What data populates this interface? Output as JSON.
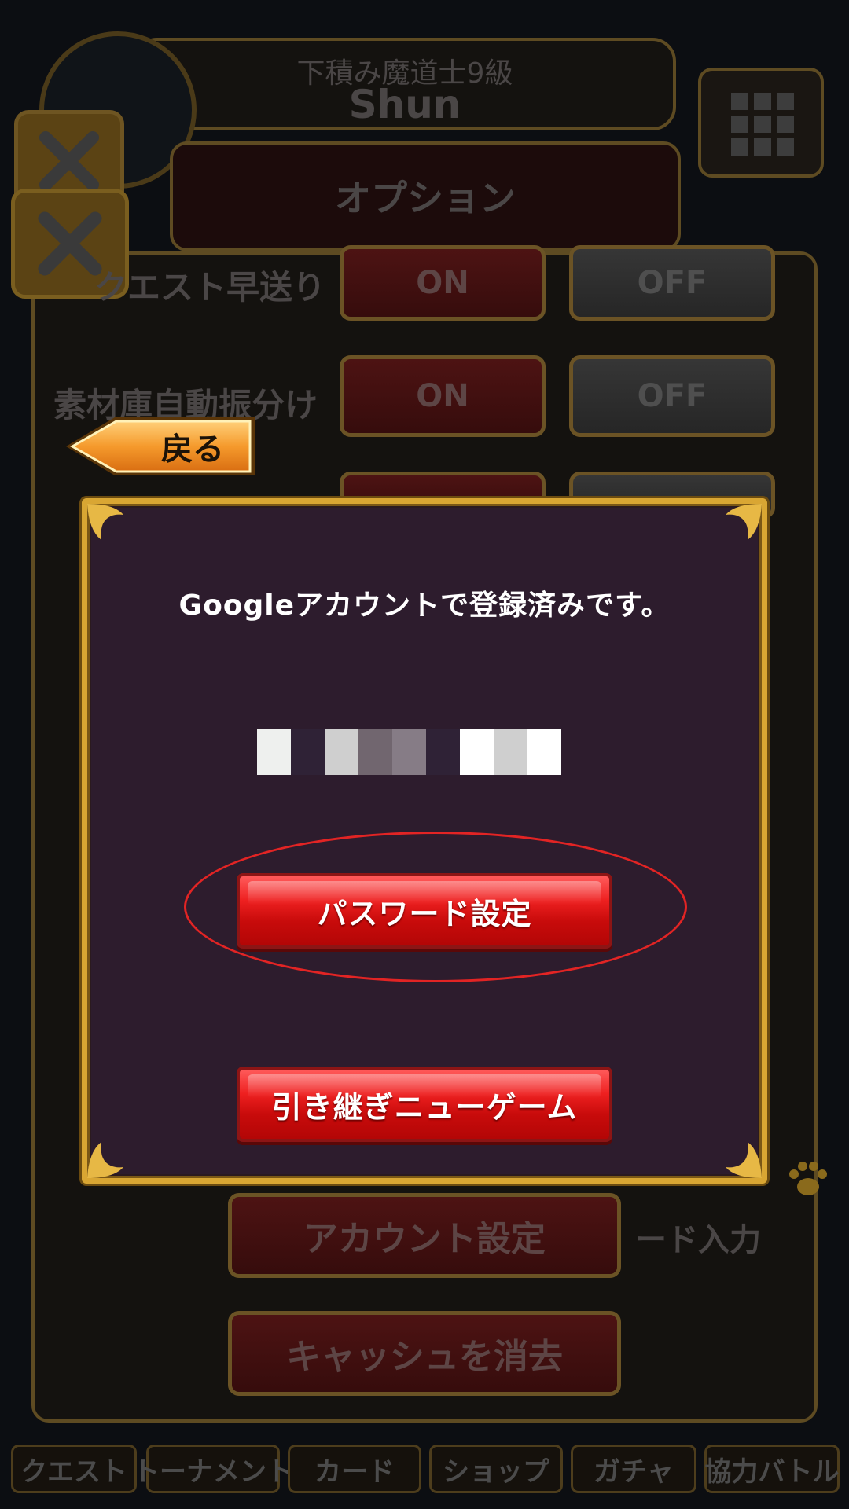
{
  "header": {
    "player_title": "下積み魔道士9級",
    "player_name": "Shun"
  },
  "option_panel": {
    "title": "オプション",
    "settings": [
      {
        "label": "クエスト早送り",
        "on_label": "ON",
        "off_label": "OFF"
      },
      {
        "label": "素材庫自動振分け",
        "on_label": "ON",
        "off_label": "OFF"
      }
    ],
    "account_button": "アカウント設定",
    "cache_button": "キャッシュを消去",
    "code_input_label": "ード入力"
  },
  "back_button": {
    "label": "戻る"
  },
  "modal": {
    "message": "Googleアカウントで登録済みです。",
    "redacted_colors": [
      "#eef0ee",
      "#2f2236",
      "#cfcfcf",
      "#71666f",
      "#867c86",
      "#2f2236",
      "#ffffff",
      "#cfcfcf",
      "#ffffff"
    ],
    "password_button": "パスワード設定",
    "new_game_button": "引き継ぎニューゲーム"
  },
  "bottom_nav": [
    {
      "label": "クエスト"
    },
    {
      "label": "トーナメント"
    },
    {
      "label": "カード"
    },
    {
      "label": "ショップ"
    },
    {
      "label": "ガチャ"
    },
    {
      "label": "協力バトル"
    }
  ],
  "colors": {
    "modal_bg": "#2d1c2d",
    "gold_frame": "#d9a633",
    "button_red": "#e81c1c",
    "highlight_ring": "#e22424"
  }
}
